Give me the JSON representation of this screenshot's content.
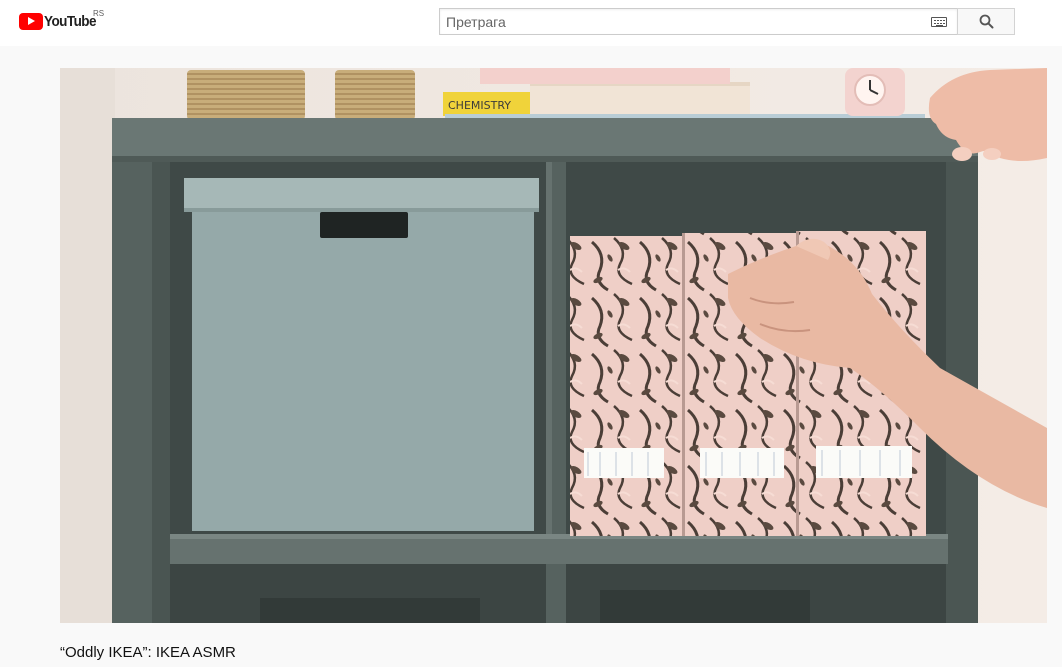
{
  "masthead": {
    "logo_text": "YouTube",
    "country_code": "RS",
    "search_placeholder": "Претрага",
    "search_value": ""
  },
  "video": {
    "title": "“Oddly IKEA”: IKEA ASMR",
    "book_spine_text": "CHEMISTRY"
  },
  "icons": {
    "logo": "youtube-play-icon",
    "keyboard": "keyboard-icon",
    "search": "search-icon"
  },
  "colors": {
    "brand_red": "#ff0000",
    "masthead_bg": "#ffffff",
    "page_bg": "#f9f9f9"
  }
}
